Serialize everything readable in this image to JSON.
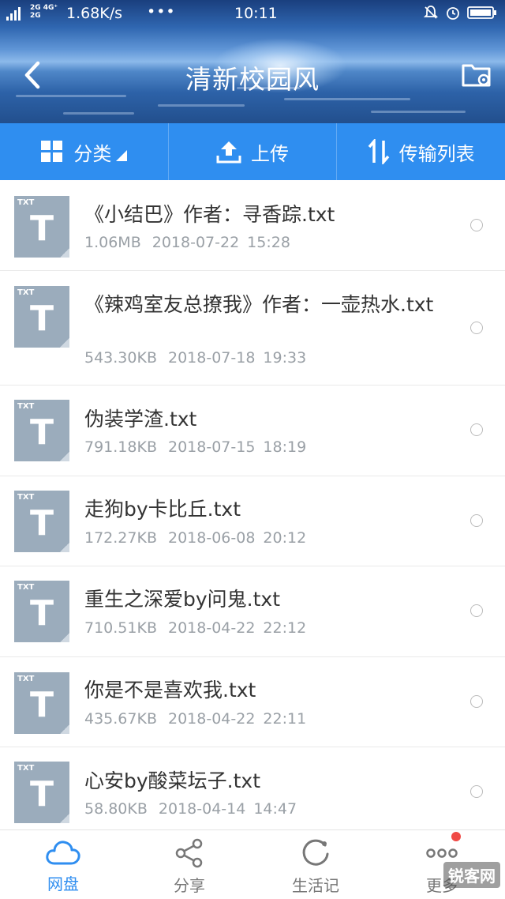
{
  "status_bar": {
    "network_top": "2G 4G⁺",
    "network_bottom": "2G",
    "speed": "1.68K/s",
    "dots": "•••",
    "time": "10:11"
  },
  "header": {
    "title": "清新校园风"
  },
  "toolbar": {
    "category_label": "分类",
    "upload_label": "上传",
    "transfer_label": "传输列表"
  },
  "files": [
    {
      "icon_tag": "TXT",
      "icon_letter": "T",
      "name": "《小结巴》作者：寻香踪.txt",
      "size": "1.06MB",
      "date": "2018-07-22",
      "time": "15:28"
    },
    {
      "icon_tag": "TXT",
      "icon_letter": "T",
      "name": "《辣鸡室友总撩我》作者：一壶热水.txt",
      "size": "543.30KB",
      "date": "2018-07-18",
      "time": "19:33"
    },
    {
      "icon_tag": "TXT",
      "icon_letter": "T",
      "name": "伪装学渣.txt",
      "size": "791.18KB",
      "date": "2018-07-15",
      "time": "18:19"
    },
    {
      "icon_tag": "TXT",
      "icon_letter": "T",
      "name": "走狗by卡比丘.txt",
      "size": "172.27KB",
      "date": "2018-06-08",
      "time": "20:12"
    },
    {
      "icon_tag": "TXT",
      "icon_letter": "T",
      "name": "重生之深爱by问鬼.txt",
      "size": "710.51KB",
      "date": "2018-04-22",
      "time": "22:12"
    },
    {
      "icon_tag": "TXT",
      "icon_letter": "T",
      "name": "你是不是喜欢我.txt",
      "size": "435.67KB",
      "date": "2018-04-22",
      "time": "22:11"
    },
    {
      "icon_tag": "TXT",
      "icon_letter": "T",
      "name": "心安by酸菜坛子.txt",
      "size": "58.80KB",
      "date": "2018-04-14",
      "time": "14:47"
    }
  ],
  "bottom_nav": {
    "items": [
      {
        "label": "网盘",
        "icon": "cloud-icon",
        "active": true
      },
      {
        "label": "分享",
        "icon": "share-icon",
        "active": false
      },
      {
        "label": "生活记",
        "icon": "life-record-icon",
        "active": false
      },
      {
        "label": "更多",
        "icon": "more-icon",
        "active": false
      }
    ]
  },
  "watermark": "锐客网",
  "colors": {
    "accent": "#2f8ef0",
    "file_icon": "#9bacbc",
    "badge": "#f04a46"
  }
}
